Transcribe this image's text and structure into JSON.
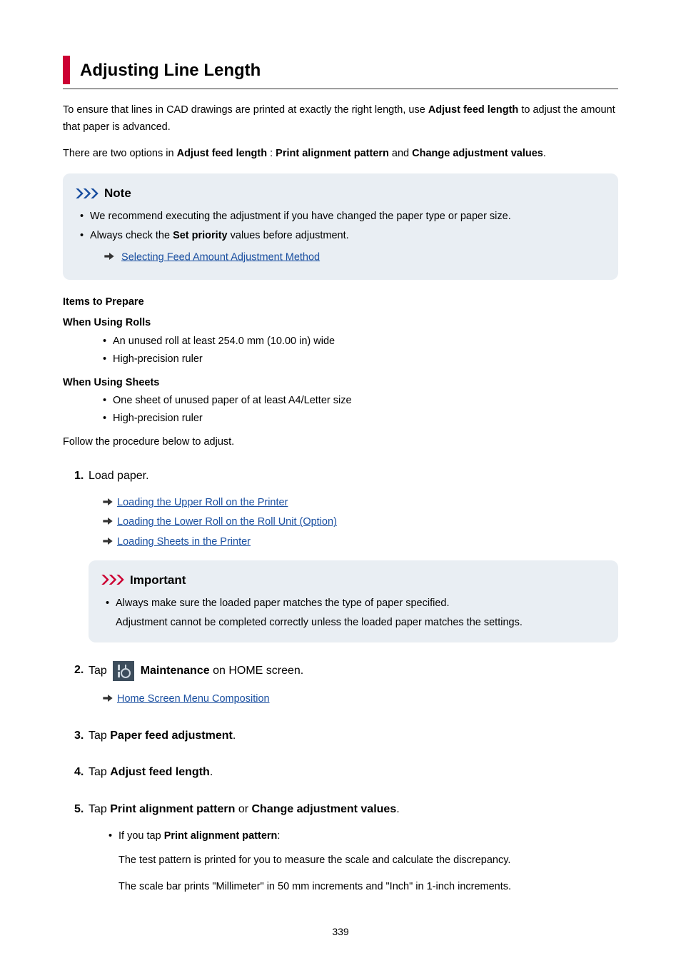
{
  "title": "Adjusting Line Length",
  "intro_para": {
    "pre": "To ensure that lines in CAD drawings are printed at exactly the right length, use ",
    "bold": "Adjust feed length",
    "post": " to adjust the amount that paper is advanced."
  },
  "options_para": {
    "pre": "There are two options in ",
    "b1": "Adjust feed length",
    "mid": " : ",
    "b2": "Print alignment pattern",
    "and": " and ",
    "b3": "Change adjustment values",
    "post": "."
  },
  "note": {
    "title": "Note",
    "items": [
      "We recommend executing the adjustment if you have changed the paper type or paper size.",
      {
        "pre": "Always check the ",
        "bold": "Set priority",
        "post": " values before adjustment."
      }
    ],
    "sublink": "Selecting Feed Amount Adjustment Method"
  },
  "prep": {
    "heading": "Items to Prepare",
    "rolls": {
      "title": "When Using Rolls",
      "items": [
        "An unused roll at least 254.0 mm (10.00 in) wide",
        "High-precision ruler"
      ]
    },
    "sheets": {
      "title": "When Using Sheets",
      "items": [
        "One sheet of unused paper of at least A4/Letter size",
        "High-precision ruler"
      ]
    }
  },
  "follow_text": "Follow the procedure below to adjust.",
  "steps": {
    "s1": {
      "text": "Load paper.",
      "links": [
        "Loading the Upper Roll on the Printer",
        "Loading the Lower Roll on the Roll Unit (Option)",
        "Loading Sheets in the Printer"
      ],
      "important": {
        "title": "Important",
        "bullet": "Always make sure the loaded paper matches the type of paper specified.",
        "body": "Adjustment cannot be completed correctly unless the loaded paper matches the settings."
      }
    },
    "s2": {
      "pre": "Tap ",
      "bold": "Maintenance",
      "post": " on HOME screen.",
      "link": "Home Screen Menu Composition"
    },
    "s3": {
      "pre": "Tap ",
      "bold": "Paper feed adjustment",
      "post": "."
    },
    "s4": {
      "pre": "Tap ",
      "bold": "Adjust feed length",
      "post": "."
    },
    "s5": {
      "pre": "Tap ",
      "b1": "Print alignment pattern",
      "mid": " or ",
      "b2": "Change adjustment values",
      "post": ".",
      "sub": {
        "pre": "If you tap ",
        "bold": "Print alignment pattern",
        "post": ":",
        "body1": "The test pattern is printed for you to measure the scale and calculate the discrepancy.",
        "body2": "The scale bar prints \"Millimeter\" in 50 mm increments and \"Inch\" in 1-inch increments."
      }
    }
  },
  "page_number": "339"
}
